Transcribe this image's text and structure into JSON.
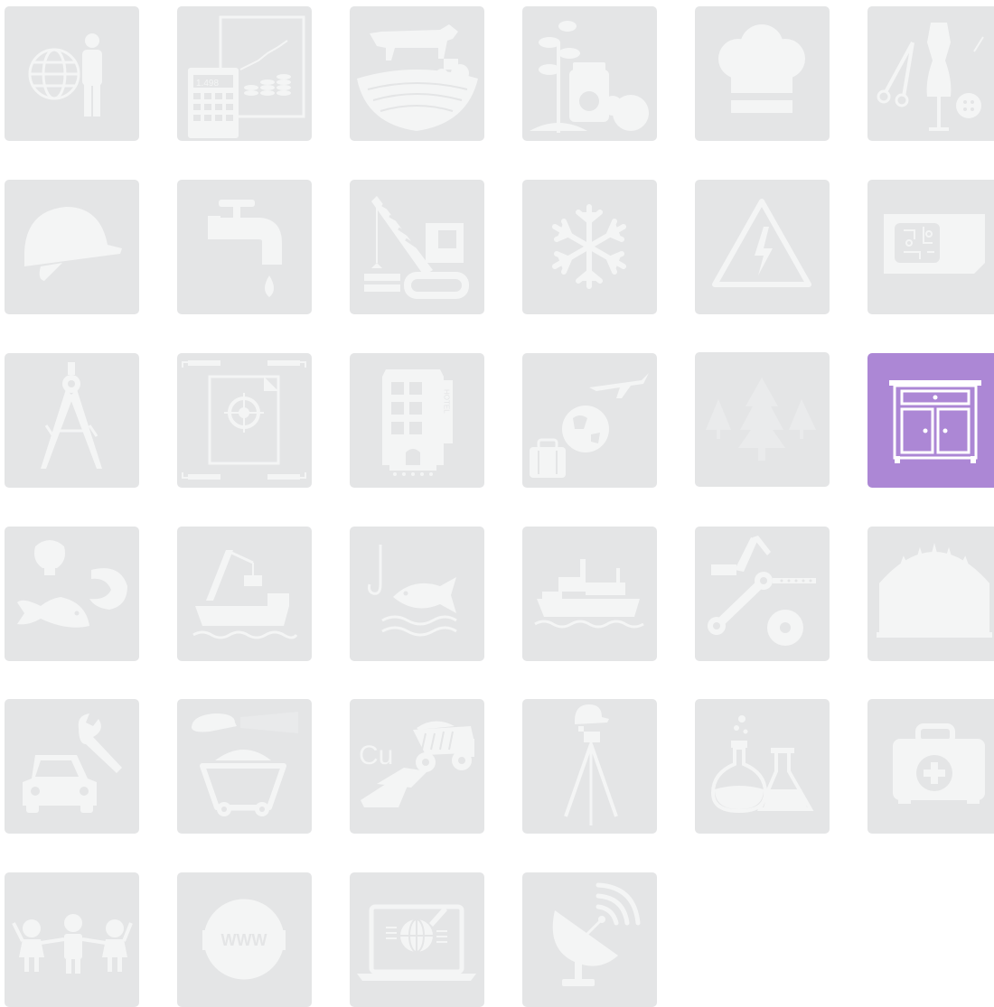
{
  "colors": {
    "tile_bg": "#e4e5e6",
    "icon_fg": "#f4f5f5",
    "selected_bg": "#ac87d5",
    "selected_fg": "#ffffff"
  },
  "tiles": [
    {
      "icon": "globe-person-icon",
      "selected": false
    },
    {
      "icon": "calculator-chart-icon",
      "selected": false,
      "text": "1.498"
    },
    {
      "icon": "cow-farm-icon",
      "selected": false
    },
    {
      "icon": "plant-jar-fruit-icon",
      "selected": false
    },
    {
      "icon": "chef-hat-icon",
      "selected": false
    },
    {
      "icon": "scissors-mannequin-icon",
      "selected": false
    },
    {
      "icon": "hard-hat-icon",
      "selected": false
    },
    {
      "icon": "water-tap-icon",
      "selected": false
    },
    {
      "icon": "crane-icon",
      "selected": false
    },
    {
      "icon": "snowflake-icon",
      "selected": false
    },
    {
      "icon": "high-voltage-warning-icon",
      "selected": false
    },
    {
      "icon": "sim-card-chip-icon",
      "selected": false
    },
    {
      "icon": "drafting-compass-icon",
      "selected": false
    },
    {
      "icon": "document-target-icon",
      "selected": false
    },
    {
      "icon": "hotel-building-icon",
      "selected": false,
      "text": "HOTEL"
    },
    {
      "icon": "travel-globe-plane-icon",
      "selected": false
    },
    {
      "icon": "forest-trees-icon",
      "selected": false
    },
    {
      "icon": "cabinet-furniture-icon",
      "selected": true
    },
    {
      "icon": "seafood-icon",
      "selected": false
    },
    {
      "icon": "ship-crane-icon",
      "selected": false
    },
    {
      "icon": "fishing-icon",
      "selected": false
    },
    {
      "icon": "cargo-ship-icon",
      "selected": false
    },
    {
      "icon": "robot-arm-gears-icon",
      "selected": false
    },
    {
      "icon": "hangar-structure-icon",
      "selected": false
    },
    {
      "icon": "car-repair-icon",
      "selected": false
    },
    {
      "icon": "mining-cart-icon",
      "selected": false
    },
    {
      "icon": "copper-mining-truck-icon",
      "selected": false,
      "text": "Cu"
    },
    {
      "icon": "surveyor-tripod-icon",
      "selected": false
    },
    {
      "icon": "chemistry-flasks-icon",
      "selected": false
    },
    {
      "icon": "first-aid-kit-icon",
      "selected": false
    },
    {
      "icon": "children-icon",
      "selected": false
    },
    {
      "icon": "www-globe-icon",
      "selected": false,
      "text": "WWW"
    },
    {
      "icon": "laptop-globe-icon",
      "selected": false
    },
    {
      "icon": "satellite-dish-icon",
      "selected": false
    }
  ]
}
